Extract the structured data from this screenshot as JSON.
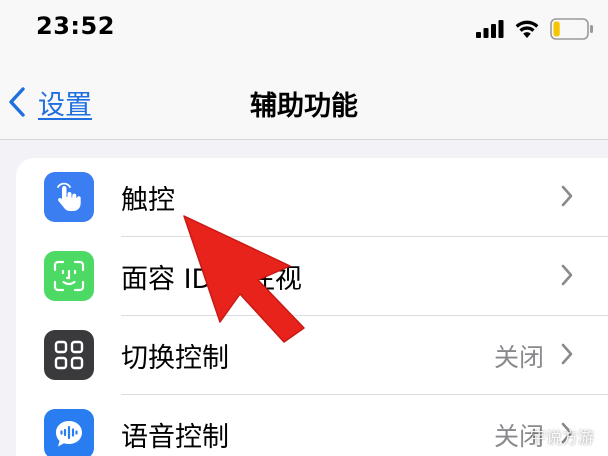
{
  "status_bar": {
    "time": "23:52",
    "icons": [
      "signal-icon",
      "wifi-icon",
      "battery-icon"
    ]
  },
  "nav": {
    "back_label": "设置",
    "title": "辅助功能"
  },
  "rows": [
    {
      "label": "触控",
      "value": "",
      "icon": "touch-hand-icon",
      "icon_color": "#3a7ef2"
    },
    {
      "label": "面容 ID 与注视",
      "value": "",
      "icon": "face-id-icon",
      "icon_color": "#4cd964"
    },
    {
      "label": "切换控制",
      "value": "关闭",
      "icon": "switch-control-icon",
      "icon_color": "#3a3a3c"
    },
    {
      "label": "语音控制",
      "value": "关闭",
      "icon": "voice-control-icon",
      "icon_color": "#2a7df0"
    }
  ],
  "colors": {
    "accent": "#1f6fe0",
    "annotation": "#e8231c",
    "battery_level": "#f7c400"
  },
  "battery_level": 0.2,
  "watermark": "宇说方游"
}
